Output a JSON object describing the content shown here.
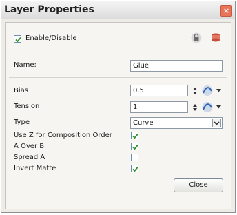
{
  "window": {
    "title": "Layer Properties",
    "close_glyph": "×"
  },
  "enable": {
    "label": "Enable/Disable",
    "checked": true
  },
  "toolbar": {
    "lock_icon": "lock-icon",
    "layer_icon": "layer-stack-icon"
  },
  "name": {
    "label": "Name:",
    "value": "Glue"
  },
  "bias": {
    "label": "Bias",
    "value": "0.5"
  },
  "tension": {
    "label": "Tension",
    "value": "1"
  },
  "type": {
    "label": "Type",
    "value": "Curve"
  },
  "use_z": {
    "label": "Use Z for Composition Order",
    "checked": true
  },
  "a_over_b": {
    "label": "A Over B",
    "checked": true
  },
  "spread_a": {
    "label": "Spread A",
    "checked": false
  },
  "invert_matte": {
    "label": "Invert Matte",
    "checked": true
  },
  "buttons": {
    "close": "Close"
  }
}
